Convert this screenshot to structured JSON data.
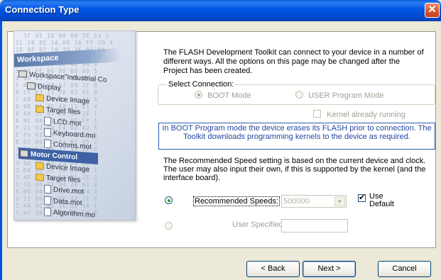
{
  "window": {
    "title": "Connection Type",
    "close_glyph": "✕"
  },
  "side_image": {
    "header": "Workspace",
    "hex_lines": [
      "  1F 4E 1D 00 00 5E 53 5",
      "1C 10 8E 1A 0D 1A FF 5D 4",
      "1E 0F 07 70 3D 3E 07 0A",
      "8 07 08 87 11 18 18 3B",
      "0 DC E5 00 5C 4D 0A D",
      "6 09 FE 06 0D B0 00 5",
      "9 1D 03 09 01 00 00 1",
      "F 03 04 02 97 00 1F 8",
      "A C5 03 11 7D 01 01 0",
      "7 E8 E0 E1 13 13 3C 5",
      "9 08 0A 3D 48 11 01 4",
      "8 8A 1C 01 00 18 2E 1",
      "A 9C 0A 57 01 0E FF 1",
      "F 21 02 24 E4 00 02 5",
      "E F6 03 47 C4 37 0C 0",
      "B 02 09 2C 04 B1 05 2",
      "7 91 92 92 17 33 92 0",
      "7 0E E0 41 5F 56 3A 7",
      "3 9A DE A5 25 24 65 9",
      "3 D4 4E 2C 54 A8 F3 1",
      "3 4F CA DA 80 55 2E 3",
      "1 1D 86 11 04 20 61 0",
      "9 06 DA 87 17 AF 04 3",
      "2 11 B6 48 0E 48 1E 0",
      "1 4A 0C 02 1C 10 3A 1",
      "1 4C 3A 71 14 10 0A 0"
    ],
    "tree": [
      {
        "label": "Workspace\"Industrial Co",
        "kind": "proj",
        "indent": 0
      },
      {
        "label": "Display",
        "kind": "proj",
        "indent": 1
      },
      {
        "label": "Device Image",
        "kind": "folder",
        "indent": 2
      },
      {
        "label": "Target files",
        "kind": "folder",
        "indent": 2
      },
      {
        "label": "LCD.mot",
        "kind": "file",
        "indent": 3
      },
      {
        "label": "Keyboard.mo",
        "kind": "file",
        "indent": 3
      },
      {
        "label": "Comms.mot",
        "kind": "file",
        "indent": 3
      },
      {
        "label": "Motor Control",
        "kind": "motor",
        "indent": 0
      },
      {
        "label": "Device Image",
        "kind": "folder",
        "indent": 2
      },
      {
        "label": "Target files",
        "kind": "folder",
        "indent": 2
      },
      {
        "label": "Drive.mot",
        "kind": "file",
        "indent": 3
      },
      {
        "label": "Data.mot",
        "kind": "file",
        "indent": 3
      },
      {
        "label": "Algorithm.mo",
        "kind": "file",
        "indent": 3
      }
    ]
  },
  "intro_text": "The FLASH Development Toolkit can connect to your device in a number of different ways. All the options on this page may be changed after the Project has been created.",
  "select_connection": {
    "legend": "Select Connection:",
    "boot_label": "BOOT Mode",
    "user_label": "USER Program Mode",
    "kernel_label": "Kernel already running"
  },
  "info_text": "In BOOT Program mode the device erases its FLASH prior to connection. The Toolkit downloads programming kernels to the device as required.",
  "speed_text": "The Recommended Speed setting is based on the current device and clock. The user may also input their own, if this is supported by the kernel (and the interface board).",
  "speed": {
    "recommended_label": "Recommended Speeds:",
    "recommended_value": "500000",
    "combo_arrow": "▼",
    "use_default_line1": "Use",
    "use_default_line2": "Default",
    "user_specified_label": "User Specified:",
    "user_specified_value": ""
  },
  "buttons": {
    "back": "< Back",
    "next": "Next >",
    "cancel": "Cancel"
  }
}
